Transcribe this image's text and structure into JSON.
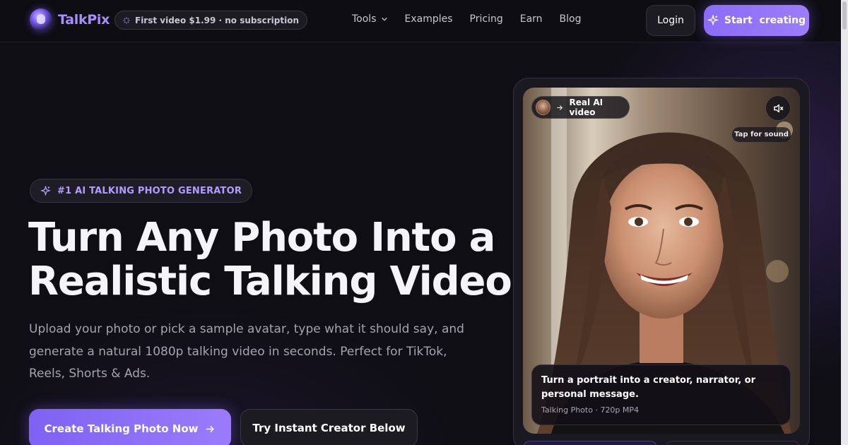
{
  "brand": {
    "name": "TalkPix"
  },
  "promo": {
    "text": "First video $1.99 · no subscription"
  },
  "nav": {
    "links": [
      "Tools",
      "Examples",
      "Pricing",
      "Earn",
      "Blog"
    ],
    "login_label": "Login",
    "start_label": "Start  creating"
  },
  "hero": {
    "badge": "#1 AI TALKING PHOTO GENERATOR",
    "headline": "Turn Any Photo Into a Realistic Talking Video",
    "headline_line1": "Turn Any Photo Into a",
    "headline_line2": "Realistic Talking Video",
    "subtext": "Upload your photo or pick a sample avatar, type what it should say, and generate a natural 1080p talking video in seconds. Perfect for TikTok, Reels, Shorts & Ads.",
    "cta_primary": "Create Talking Photo Now",
    "cta_secondary": "Try Instant Creator Below"
  },
  "video_card": {
    "chip_label": "Real AI video",
    "tap_for_sound": "Tap for sound",
    "caption_title": "Turn a portrait into a creator, narrator, or personal message.",
    "caption_meta": "Talking Photo · 720p MP4"
  },
  "colors": {
    "accent": "#8b6cf6",
    "accent_light": "#b49cff",
    "background": "#0f0e14"
  },
  "icons": {
    "promo": "sparkle-icon",
    "tools_dropdown": "chevron-down-icon",
    "start": "sparkle-icon",
    "badge": "sparkle-icon",
    "cta": "arrow-right-icon",
    "chip": "arrow-right-icon",
    "mute": "speaker-muted-icon"
  }
}
